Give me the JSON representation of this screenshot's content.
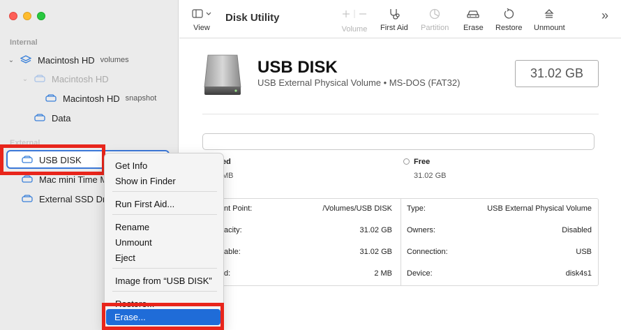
{
  "sidebar": {
    "sections": {
      "internal": "Internal",
      "external": "External"
    },
    "items": [
      {
        "label": "Macintosh HD",
        "sub": "volumes"
      },
      {
        "label": "Macintosh HD",
        "sub": ""
      },
      {
        "label": "Macintosh HD",
        "sub": "snapshot"
      },
      {
        "label": "Data",
        "sub": ""
      },
      {
        "label": "USB DISK",
        "sub": ""
      },
      {
        "label": "Mac mini Time M",
        "sub": ""
      },
      {
        "label": "External SSD Dr",
        "sub": ""
      }
    ]
  },
  "toolbar": {
    "view_label": "View",
    "title": "Disk Utility",
    "volume_label": "Volume",
    "first_aid_label": "First Aid",
    "partition_label": "Partition",
    "erase_label": "Erase",
    "restore_label": "Restore",
    "unmount_label": "Unmount",
    "more_label": "»"
  },
  "disk": {
    "name": "USB DISK",
    "description": "USB External Physical Volume • MS-DOS (FAT32)",
    "size": "31.02 GB"
  },
  "usage": {
    "used_label": "ed",
    "used_value": "MB",
    "free_label": "Free",
    "free_value": "31.02 GB"
  },
  "info": {
    "left": [
      {
        "key": "nt Point:",
        "value": "/Volumes/USB DISK"
      },
      {
        "key": "acity:",
        "value": "31.02 GB"
      },
      {
        "key": "able:",
        "value": "31.02 GB"
      },
      {
        "key": "d:",
        "value": "2 MB"
      }
    ],
    "right": [
      {
        "key": "Type:",
        "value": "USB External Physical Volume"
      },
      {
        "key": "Owners:",
        "value": "Disabled"
      },
      {
        "key": "Connection:",
        "value": "USB"
      },
      {
        "key": "Device:",
        "value": "disk4s1"
      }
    ]
  },
  "context_menu": {
    "items": [
      "Get Info",
      "Show in Finder",
      "Run First Aid...",
      "Rename",
      "Unmount",
      "Eject",
      "Image from “USB DISK”",
      "Restore...",
      "Erase..."
    ]
  },
  "colors": {
    "highlight": "#1f6cd8",
    "annotation": "#e8251b",
    "selection_border": "#3b78d8"
  }
}
